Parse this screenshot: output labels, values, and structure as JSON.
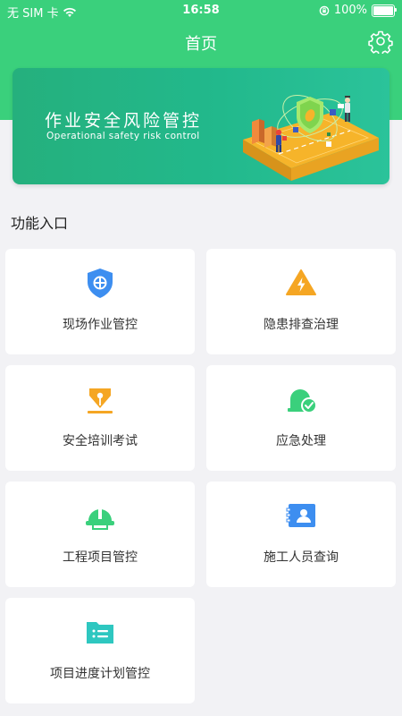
{
  "status_bar": {
    "carrier": "无 SIM 卡",
    "time": "16:58",
    "battery": "100%",
    "battery_level": 1.0
  },
  "nav": {
    "title": "首页",
    "settings_icon": "gear-icon"
  },
  "banner": {
    "title": "作业安全风险管控",
    "subtitle": "Operational safety risk control"
  },
  "section": {
    "title": "功能入口"
  },
  "features": [
    {
      "label": "现场作业管控",
      "icon": "shield-icon",
      "color": "#3d8ef0"
    },
    {
      "label": "隐患排查治理",
      "icon": "warning-icon",
      "color": "#f5a623"
    },
    {
      "label": "安全培训考试",
      "icon": "pen-nib-icon",
      "color": "#f5a623"
    },
    {
      "label": "应急处理",
      "icon": "alarm-check-icon",
      "color": "#3ad07c"
    },
    {
      "label": "工程项目管控",
      "icon": "helmet-icon",
      "color": "#3ad07c"
    },
    {
      "label": "施工人员查询",
      "icon": "id-card-icon",
      "color": "#3d8ef0"
    },
    {
      "label": "项目进度计划管控",
      "icon": "folder-list-icon",
      "color": "#2ec7c0"
    }
  ],
  "colors": {
    "header": "#3ad07c",
    "banner": "#25b07d",
    "background": "#f2f2f5"
  }
}
